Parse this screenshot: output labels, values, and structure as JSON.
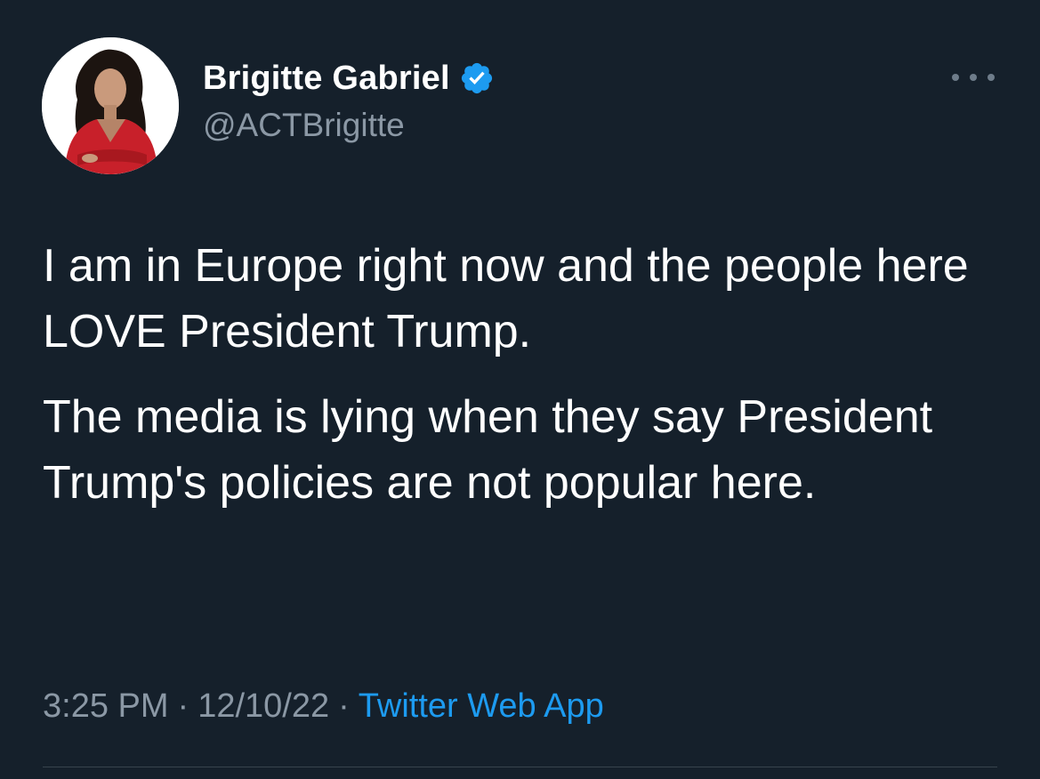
{
  "tweet": {
    "author": {
      "display_name": "Brigitte Gabriel",
      "handle": "@ACTBrigitte",
      "verified_icon": "verified-badge-icon",
      "avatar_icon": "profile-photo"
    },
    "more_icon": "more-options-icon",
    "text_paragraphs": [
      "I am in Europe right now and the people here LOVE President Trump.",
      "The media is lying when they say President Trump's policies are not popular here."
    ],
    "meta": {
      "time": "3:25 PM",
      "separator": "·",
      "date": "12/10/22",
      "source": "Twitter Web App"
    },
    "colors": {
      "background": "#15202b",
      "text": "#ffffff",
      "secondary_text": "#8b98a5",
      "accent": "#1d9bf0",
      "divider": "#38444d"
    }
  }
}
